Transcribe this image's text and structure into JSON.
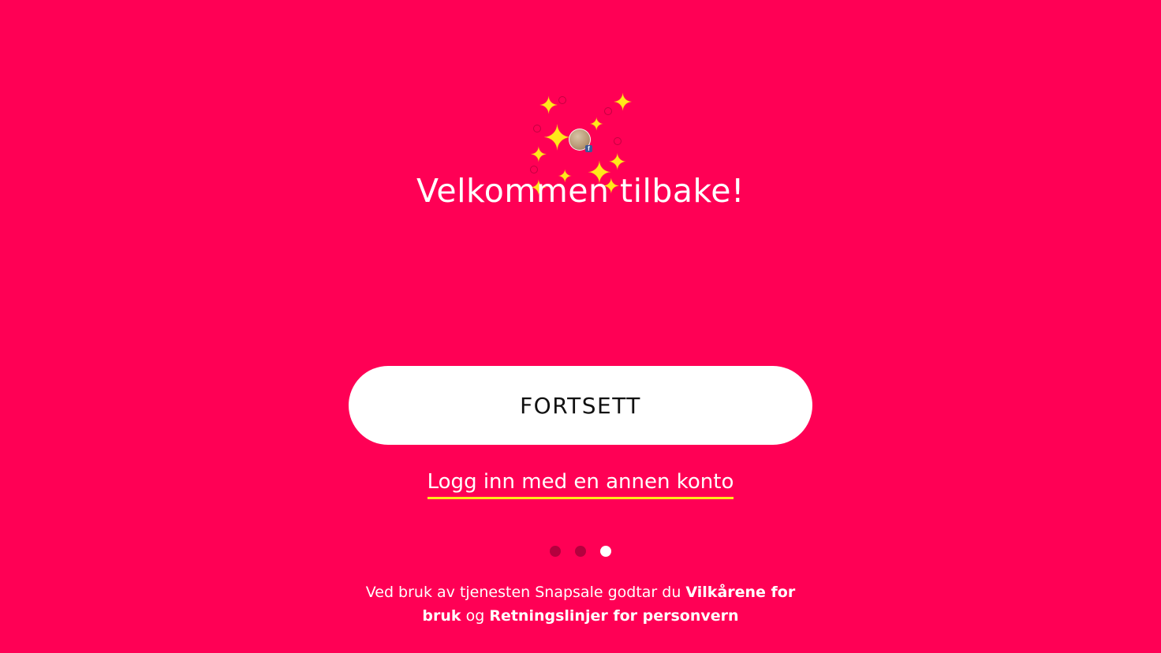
{
  "hero": {
    "title": "Velkommen tilbake!",
    "avatar_icon": "profile-photo-icon",
    "badge_icon": "facebook-icon",
    "badge_glyph": "f",
    "sparkle_glyph": "✦",
    "sparkle_color": "#ffe81a"
  },
  "actions": {
    "continue_label": "FORTSETT",
    "alt_login_label": "Logg inn med en annen konto"
  },
  "pager": {
    "total": 3,
    "current": 3
  },
  "terms": {
    "prefix": "Ved bruk av tjenesten Snapsale godtar du ",
    "terms_link": "Vilkårene for bruk",
    "conjunction": " og ",
    "privacy_link": "Retningslinjer for personvern"
  },
  "theme": {
    "background": "#ff0055",
    "accent": "#ffe81a",
    "button_bg": "#ffffff",
    "button_text": "#111111"
  }
}
